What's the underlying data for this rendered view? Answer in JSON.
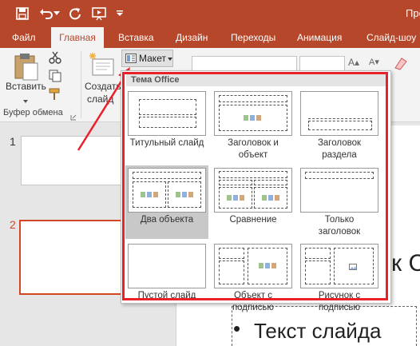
{
  "colors": {
    "accent": "#b7472a",
    "highlight": "#e8212b",
    "selected_thumb": "#d24726"
  },
  "qat": {
    "icons": [
      "save-icon",
      "undo-icon",
      "redo-icon",
      "slideshow-icon"
    ],
    "title_partial": "Пре"
  },
  "tabs": [
    "Файл",
    "Главная",
    "Вставка",
    "Дизайн",
    "Переходы",
    "Анимация",
    "Слайд-шоу"
  ],
  "active_tab": "Главная",
  "ribbon": {
    "paste_label": "Вставить",
    "new_slide_label_1": "Создать",
    "new_slide_label_2": "слайд",
    "layout_button_label": "Макет",
    "clipboard_group": "Буфер обмена"
  },
  "slides": [
    {
      "number": "1"
    },
    {
      "number": "2"
    }
  ],
  "canvas": {
    "title_fragment": "к С",
    "bullet": "•",
    "body_text": "Текст слайда"
  },
  "layout_gallery": {
    "header": "Тема Office",
    "items": [
      {
        "label": "Титульный слайд",
        "selected": false
      },
      {
        "label": "Заголовок и\nобъект",
        "selected": false
      },
      {
        "label": "Заголовок\nраздела",
        "selected": false
      },
      {
        "label": "Два объекта",
        "selected": true
      },
      {
        "label": "Сравнение",
        "selected": false
      },
      {
        "label": "Только\nзаголовок",
        "selected": false
      },
      {
        "label": "Пустой слайд",
        "selected": false
      },
      {
        "label": "Объект с\nподписью",
        "selected": false
      },
      {
        "label": "Рисунок с\nподписью",
        "selected": false
      }
    ]
  }
}
